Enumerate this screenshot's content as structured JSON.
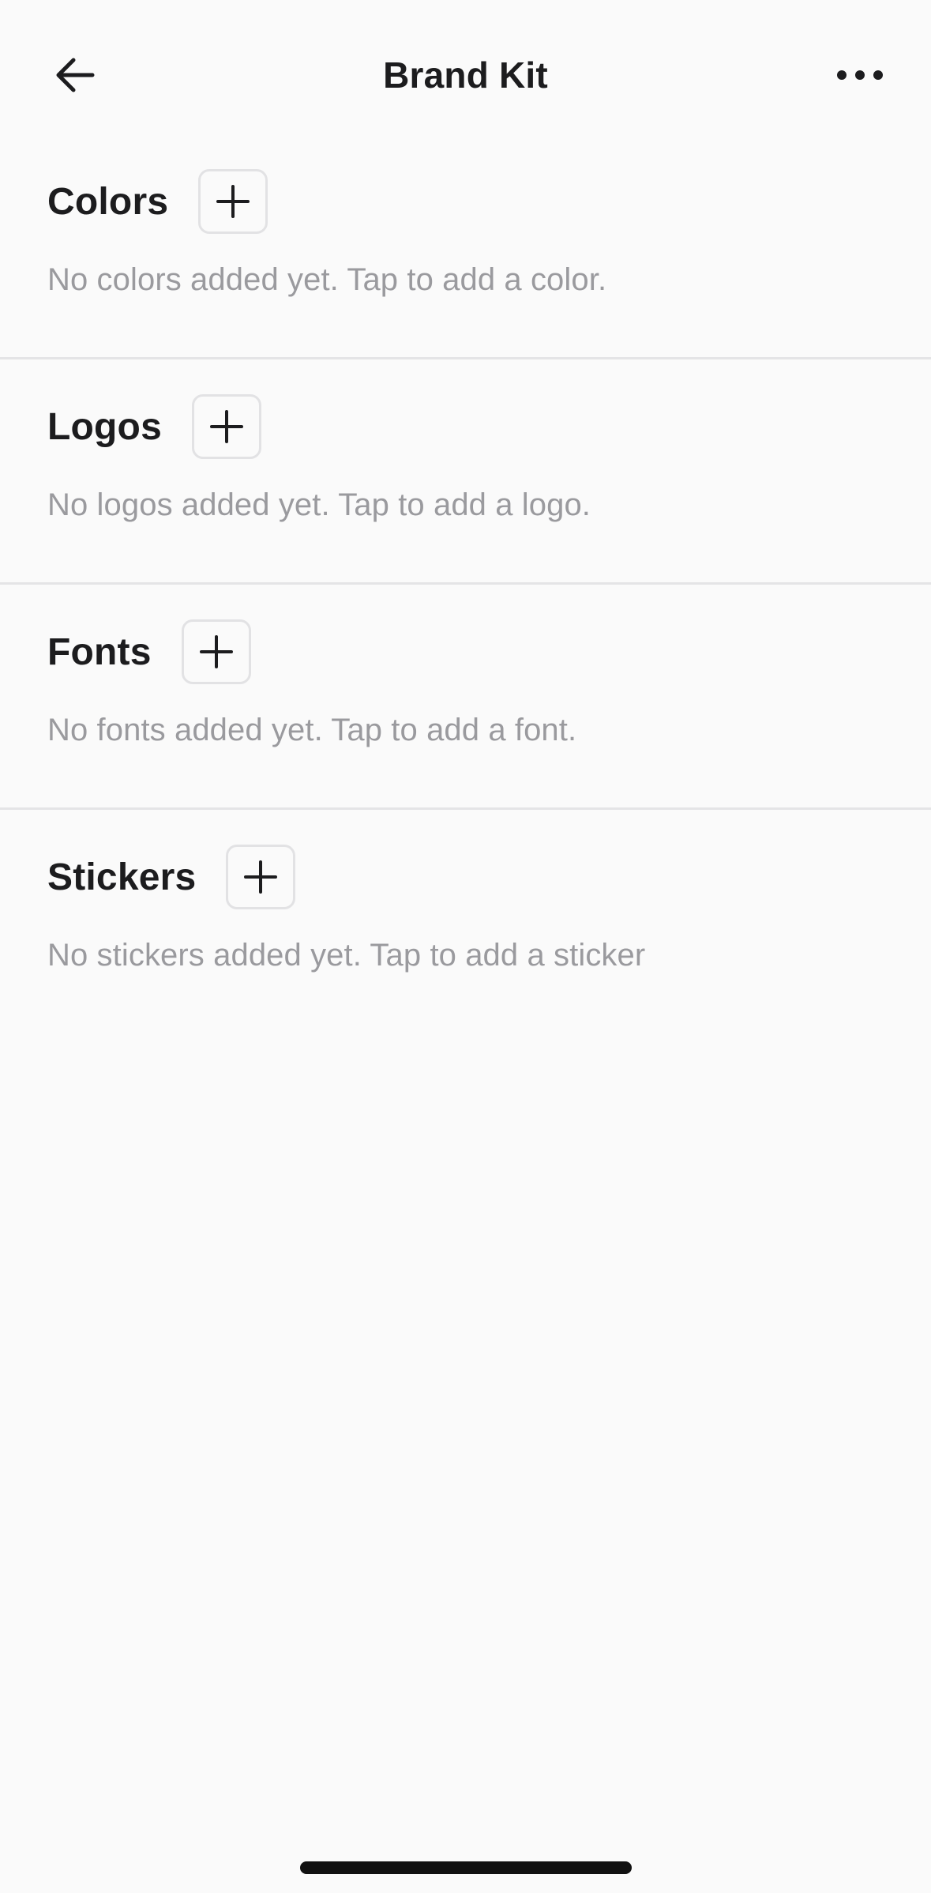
{
  "header": {
    "title": "Brand Kit",
    "back_icon": "arrow-left-icon",
    "more_icon": "more-horizontal-icon"
  },
  "sections": [
    {
      "title": "Colors",
      "hint": "No colors added yet. Tap to add a color."
    },
    {
      "title": "Logos",
      "hint": "No logos added yet. Tap to add a logo."
    },
    {
      "title": "Fonts",
      "hint": "No fonts added yet. Tap to add a font."
    },
    {
      "title": "Stickers",
      "hint": "No stickers added yet. Tap to add a sticker"
    }
  ],
  "colors": {
    "background": "#fafafa",
    "text": "#1c1c1e",
    "muted": "#9a9a9e",
    "divider": "#e4e4e6"
  }
}
